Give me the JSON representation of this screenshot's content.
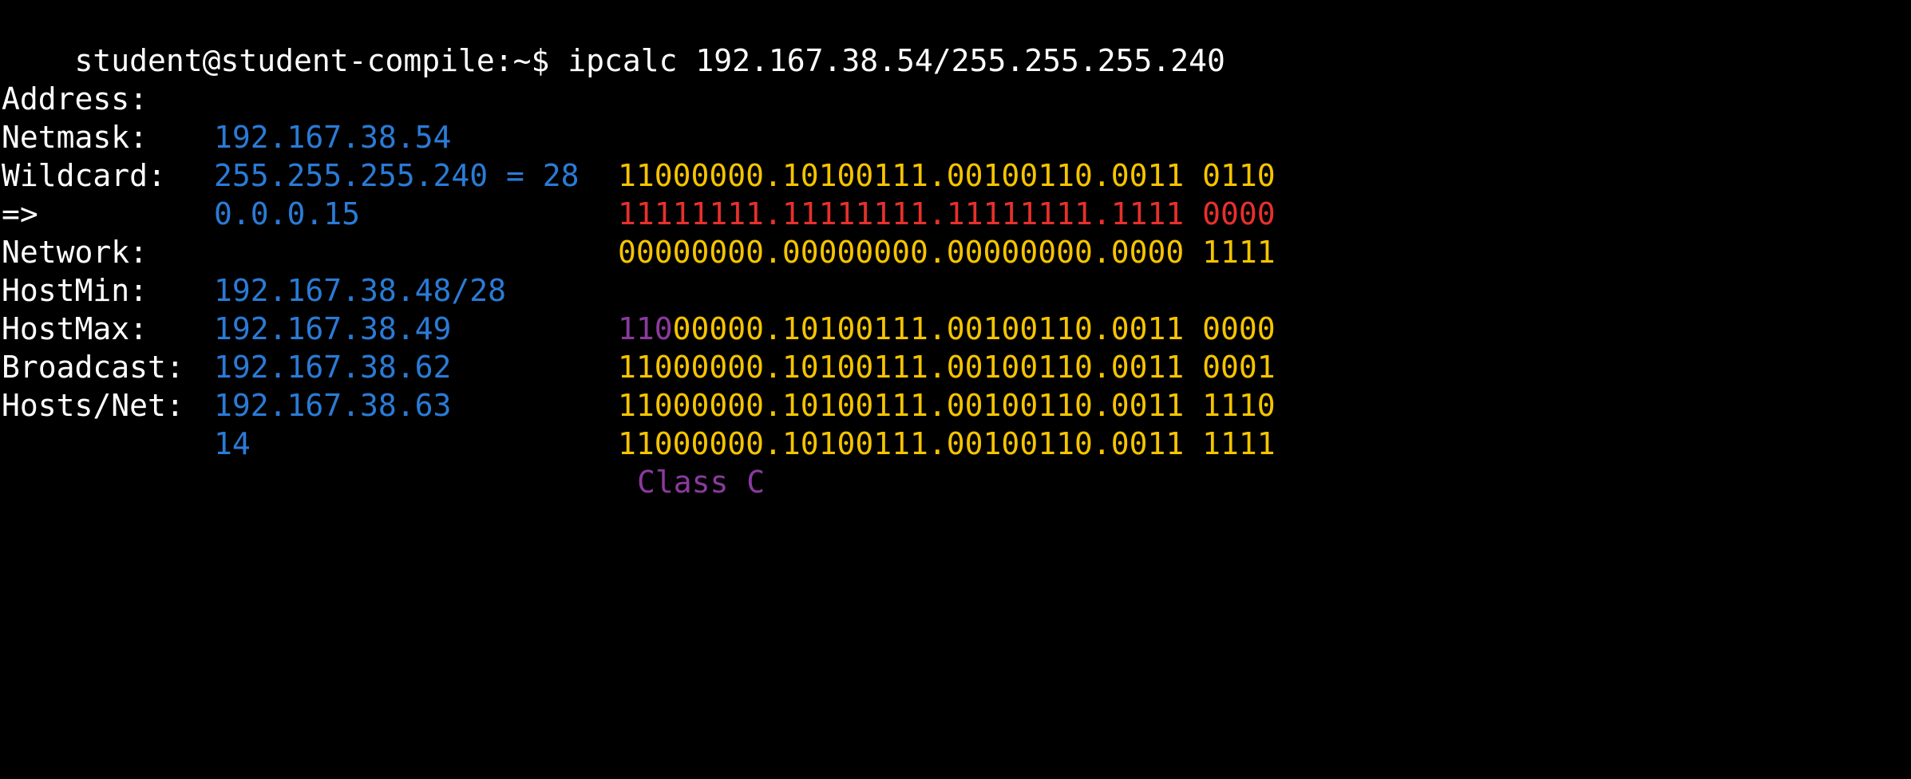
{
  "colors": {
    "background": "#000000",
    "text": "#ffffff",
    "value": "#2a7bd6",
    "binary": "#f5c400",
    "mask": "#e8302c",
    "class": "#8b3a9e"
  },
  "prompt": {
    "user_host": "student@student-compile",
    "path_symbol": ":~$",
    "command": "ipcalc 192.167.38.54/255.255.255.240"
  },
  "rows": {
    "address": {
      "label": "Address:",
      "value": "192.167.38.54",
      "binary": "11000000.10100111.00100110.0011",
      "binary_tail": "0110"
    },
    "netmask": {
      "label": "Netmask:",
      "value": "255.255.255.240 = 28",
      "binary": "11111111.11111111.11111111.1111",
      "binary_tail": "0000"
    },
    "wildcard": {
      "label": "Wildcard:",
      "value": "0.0.0.15",
      "binary": "00000000.00000000.00000000.0000",
      "binary_tail": "1111"
    },
    "arrow": {
      "label": "=>"
    },
    "network": {
      "label": "Network:",
      "value": "192.167.38.48/28",
      "binary_class_bits": "110",
      "binary": "00000.10100111.00100110.0011",
      "binary_tail": "0000"
    },
    "hostmin": {
      "label": "HostMin:",
      "value": "192.167.38.49",
      "binary": "11000000.10100111.00100110.0011",
      "binary_tail": "0001"
    },
    "hostmax": {
      "label": "HostMax:",
      "value": "192.167.38.62",
      "binary": "11000000.10100111.00100110.0011",
      "binary_tail": "1110"
    },
    "broadcast": {
      "label": "Broadcast:",
      "value": "192.167.38.63",
      "binary": "11000000.10100111.00100110.0011",
      "binary_tail": "1111"
    },
    "hosts": {
      "label": "Hosts/Net:",
      "value": "14",
      "class_text": "Class C"
    }
  }
}
